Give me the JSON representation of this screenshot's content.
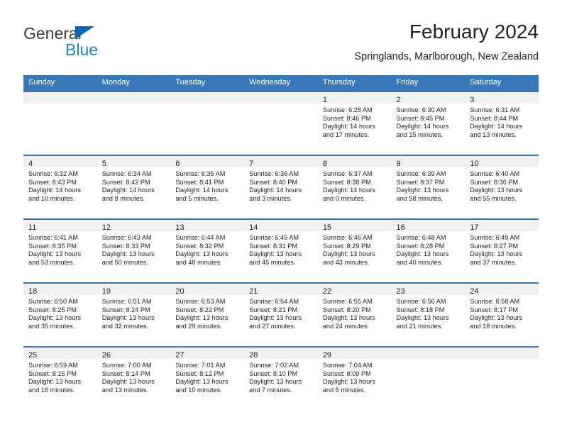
{
  "brand": {
    "name_part1": "General",
    "name_part2": "Blue",
    "logo_icon": "triangle-icon",
    "color_dark": "#3c3c3b",
    "color_blue": "#1c84d0"
  },
  "header": {
    "title": "February 2024",
    "subtitle": "Springlands, Marlborough, New Zealand"
  },
  "theme": {
    "header_band": "#3878b8",
    "daynum_strip": "#f1f1f1",
    "text": "#231f20"
  },
  "weekdays": [
    "Sunday",
    "Monday",
    "Tuesday",
    "Wednesday",
    "Thursday",
    "Friday",
    "Saturday"
  ],
  "weeks": [
    [
      {
        "day": "",
        "lines": []
      },
      {
        "day": "",
        "lines": []
      },
      {
        "day": "",
        "lines": []
      },
      {
        "day": "",
        "lines": []
      },
      {
        "day": "1",
        "lines": [
          "Sunrise: 6:28 AM",
          "Sunset: 8:46 PM",
          "Daylight: 14 hours",
          "and 17 minutes."
        ]
      },
      {
        "day": "2",
        "lines": [
          "Sunrise: 6:30 AM",
          "Sunset: 8:45 PM",
          "Daylight: 14 hours",
          "and 15 minutes."
        ]
      },
      {
        "day": "3",
        "lines": [
          "Sunrise: 6:31 AM",
          "Sunset: 8:44 PM",
          "Daylight: 14 hours",
          "and 13 minutes."
        ]
      }
    ],
    [
      {
        "day": "4",
        "lines": [
          "Sunrise: 6:32 AM",
          "Sunset: 8:43 PM",
          "Daylight: 14 hours",
          "and 10 minutes."
        ]
      },
      {
        "day": "5",
        "lines": [
          "Sunrise: 6:34 AM",
          "Sunset: 8:42 PM",
          "Daylight: 14 hours",
          "and 8 minutes."
        ]
      },
      {
        "day": "6",
        "lines": [
          "Sunrise: 6:35 AM",
          "Sunset: 8:41 PM",
          "Daylight: 14 hours",
          "and 5 minutes."
        ]
      },
      {
        "day": "7",
        "lines": [
          "Sunrise: 6:36 AM",
          "Sunset: 8:40 PM",
          "Daylight: 14 hours",
          "and 3 minutes."
        ]
      },
      {
        "day": "8",
        "lines": [
          "Sunrise: 6:37 AM",
          "Sunset: 8:38 PM",
          "Daylight: 14 hours",
          "and 0 minutes."
        ]
      },
      {
        "day": "9",
        "lines": [
          "Sunrise: 6:39 AM",
          "Sunset: 8:37 PM",
          "Daylight: 13 hours",
          "and 58 minutes."
        ]
      },
      {
        "day": "10",
        "lines": [
          "Sunrise: 6:40 AM",
          "Sunset: 8:36 PM",
          "Daylight: 13 hours",
          "and 55 minutes."
        ]
      }
    ],
    [
      {
        "day": "11",
        "lines": [
          "Sunrise: 6:41 AM",
          "Sunset: 8:35 PM",
          "Daylight: 13 hours",
          "and 53 minutes."
        ]
      },
      {
        "day": "12",
        "lines": [
          "Sunrise: 6:43 AM",
          "Sunset: 8:33 PM",
          "Daylight: 13 hours",
          "and 50 minutes."
        ]
      },
      {
        "day": "13",
        "lines": [
          "Sunrise: 6:44 AM",
          "Sunset: 8:32 PM",
          "Daylight: 13 hours",
          "and 48 minutes."
        ]
      },
      {
        "day": "14",
        "lines": [
          "Sunrise: 6:45 AM",
          "Sunset: 8:31 PM",
          "Daylight: 13 hours",
          "and 45 minutes."
        ]
      },
      {
        "day": "15",
        "lines": [
          "Sunrise: 6:46 AM",
          "Sunset: 8:29 PM",
          "Daylight: 13 hours",
          "and 43 minutes."
        ]
      },
      {
        "day": "16",
        "lines": [
          "Sunrise: 6:48 AM",
          "Sunset: 8:28 PM",
          "Daylight: 13 hours",
          "and 40 minutes."
        ]
      },
      {
        "day": "17",
        "lines": [
          "Sunrise: 6:49 AM",
          "Sunset: 8:27 PM",
          "Daylight: 13 hours",
          "and 37 minutes."
        ]
      }
    ],
    [
      {
        "day": "18",
        "lines": [
          "Sunrise: 6:50 AM",
          "Sunset: 8:25 PM",
          "Daylight: 13 hours",
          "and 35 minutes."
        ]
      },
      {
        "day": "19",
        "lines": [
          "Sunrise: 6:51 AM",
          "Sunset: 8:24 PM",
          "Daylight: 13 hours",
          "and 32 minutes."
        ]
      },
      {
        "day": "20",
        "lines": [
          "Sunrise: 6:53 AM",
          "Sunset: 8:22 PM",
          "Daylight: 13 hours",
          "and 29 minutes."
        ]
      },
      {
        "day": "21",
        "lines": [
          "Sunrise: 6:54 AM",
          "Sunset: 8:21 PM",
          "Daylight: 13 hours",
          "and 27 minutes."
        ]
      },
      {
        "day": "22",
        "lines": [
          "Sunrise: 6:55 AM",
          "Sunset: 8:20 PM",
          "Daylight: 13 hours",
          "and 24 minutes."
        ]
      },
      {
        "day": "23",
        "lines": [
          "Sunrise: 6:56 AM",
          "Sunset: 8:18 PM",
          "Daylight: 13 hours",
          "and 21 minutes."
        ]
      },
      {
        "day": "24",
        "lines": [
          "Sunrise: 6:58 AM",
          "Sunset: 8:17 PM",
          "Daylight: 13 hours",
          "and 18 minutes."
        ]
      }
    ],
    [
      {
        "day": "25",
        "lines": [
          "Sunrise: 6:59 AM",
          "Sunset: 8:15 PM",
          "Daylight: 13 hours",
          "and 16 minutes."
        ]
      },
      {
        "day": "26",
        "lines": [
          "Sunrise: 7:00 AM",
          "Sunset: 8:14 PM",
          "Daylight: 13 hours",
          "and 13 minutes."
        ]
      },
      {
        "day": "27",
        "lines": [
          "Sunrise: 7:01 AM",
          "Sunset: 8:12 PM",
          "Daylight: 13 hours",
          "and 10 minutes."
        ]
      },
      {
        "day": "28",
        "lines": [
          "Sunrise: 7:02 AM",
          "Sunset: 8:10 PM",
          "Daylight: 13 hours",
          "and 7 minutes."
        ]
      },
      {
        "day": "29",
        "lines": [
          "Sunrise: 7:04 AM",
          "Sunset: 8:09 PM",
          "Daylight: 13 hours",
          "and 5 minutes."
        ]
      },
      {
        "day": "",
        "lines": []
      },
      {
        "day": "",
        "lines": []
      }
    ]
  ]
}
